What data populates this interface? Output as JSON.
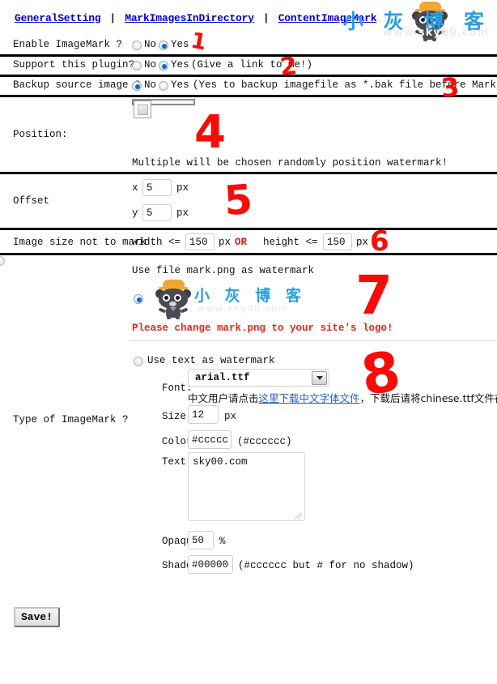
{
  "nav": {
    "links": [
      {
        "label": "GeneralSetting"
      },
      {
        "label": "MarkImagesInDirectory"
      },
      {
        "label": "ContentImageMark"
      }
    ],
    "separator": "|"
  },
  "brand": {
    "chinese": "小 灰 博 客",
    "url": "www.sky00.com",
    "mascot_icon": "cat-mascot-icon"
  },
  "rows": {
    "enable": {
      "label": "Enable ImageMark ?",
      "no_label": "No",
      "yes_label": "Yes",
      "selected": "Yes"
    },
    "support": {
      "label": "Support this plugin?",
      "no_label": "No",
      "yes_label": "Yes",
      "yes_suffix": "(Give a link to me!)",
      "selected": "Yes"
    },
    "backup": {
      "label": "Backup source image ?",
      "no_label": "No",
      "yes_label": "Yes",
      "yes_suffix": "(Yes to backup imagefile as *.bak file before Mark!)",
      "selected": "No"
    },
    "position": {
      "label": "Position:",
      "cells": [
        {
          "checked": false
        },
        {
          "checked": false
        },
        {
          "checked": true
        },
        {
          "checked": false
        },
        {
          "checked": false
        },
        {
          "checked": false
        },
        {
          "checked": false
        },
        {
          "checked": false
        },
        {
          "checked": false
        }
      ],
      "hint": "Multiple will be chosen randomly position watermark!"
    },
    "offset": {
      "label": "Offset",
      "x_label": "x",
      "x_value": "5",
      "x_unit": "px",
      "y_label": "y",
      "y_value": "5",
      "y_unit": "px"
    },
    "imagesize": {
      "label": "Image size not to mark",
      "width_label": "width <=",
      "width_value": "150",
      "width_unit": "px",
      "or_label": "OR",
      "height_label": "height <=",
      "height_value": "150",
      "height_unit": "px"
    },
    "type": {
      "label": "Type of ImageMark ?",
      "file_option": {
        "text": "Use file mark.png as watermark",
        "file_name": "mark.png",
        "selected": true,
        "warning": "Please change mark.png to your site's logo!",
        "preview_chinese": "小 灰 博 客",
        "preview_url": "www.sky00.com"
      },
      "text_option": {
        "text": "Use text as watermark",
        "selected": false,
        "font_label": "Font:",
        "font_value": "arial.ttf",
        "font_note_pre": "中文用户请点击",
        "font_note_link": "这里下载中文字体文件",
        "font_note_post": "，下载后请将chinese.ttf文件存入",
        "size_label": "Size:",
        "size_value": "12",
        "size_unit": "px",
        "color_label": "Color:",
        "color_value": "#cccccc",
        "color_hint": "(#cccccc)",
        "text_label": "Text:",
        "text_value": "sky00.com",
        "opaque_label": "Opaque:",
        "opaque_value": "50",
        "opaque_unit": "%",
        "shadow_label": "Shadow:",
        "shadow_value": "#000000",
        "shadow_hint": "(#cccccc but # for no shadow)"
      }
    }
  },
  "save": {
    "label": "Save!"
  },
  "annotations": [
    {
      "label": "1"
    },
    {
      "label": "2"
    },
    {
      "label": "3"
    },
    {
      "label": "4"
    },
    {
      "label": "5"
    },
    {
      "label": "6"
    },
    {
      "label": "7"
    },
    {
      "label": "8"
    }
  ],
  "colors": {
    "link": "#0000cc",
    "brand_blue": "#2a9fe0",
    "annotation_red": "#fb0a07",
    "warning_red": "#e8251b",
    "divider": "#000000"
  }
}
